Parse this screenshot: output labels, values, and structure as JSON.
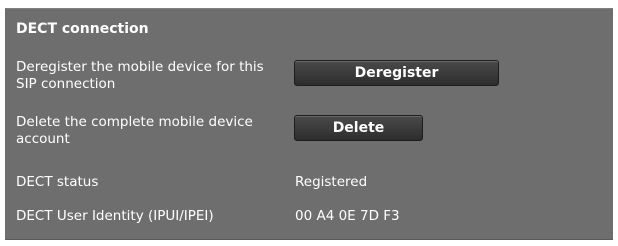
{
  "section": {
    "title": "DECT connection"
  },
  "rows": {
    "deregister": {
      "label": "Deregister the mobile device for this SIP connection",
      "button_label": "Deregister"
    },
    "delete": {
      "label": "Delete the complete mobile device account",
      "button_label": "Delete"
    },
    "status": {
      "label": "DECT status",
      "value": "Registered"
    },
    "identity": {
      "label": "DECT User Identity (IPUI/IPEI)",
      "value": "00 A4 0E 7D F3"
    }
  },
  "colors": {
    "panel_background": "#6e6e6e",
    "text": "#ffffff",
    "button_background": "#3a3a3a"
  }
}
